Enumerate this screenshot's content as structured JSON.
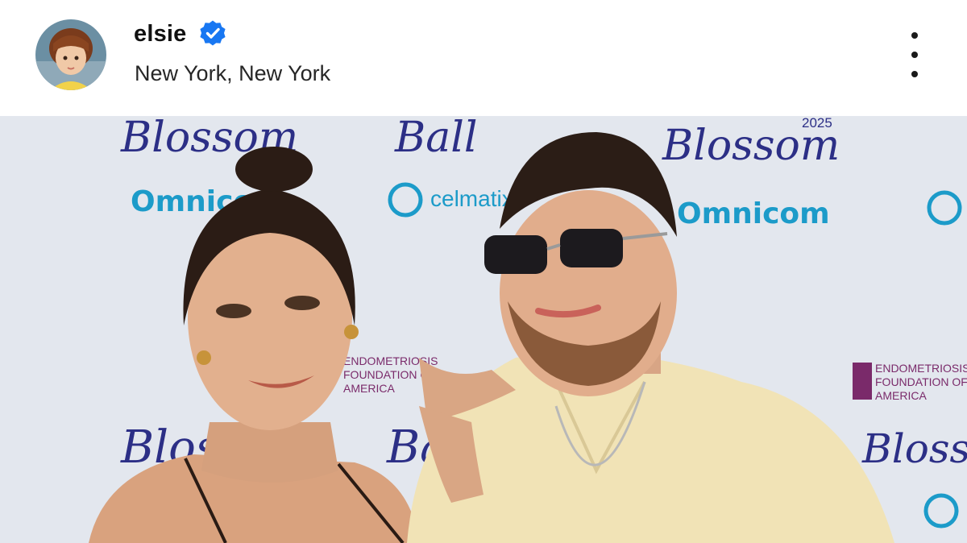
{
  "post_header": {
    "username": "elsie",
    "verified": true,
    "location": "New York, New York",
    "avatar_icon": "profile-photo-child",
    "more_icon": "more-vertical-icon"
  },
  "post_image": {
    "backdrop": {
      "year": "2025",
      "event_words": [
        "Blossom",
        "Ball"
      ],
      "sponsors": [
        "Omnicom",
        "celmatix"
      ],
      "foundation_lines": [
        "ENDOMETRIOSIS",
        "FOUNDATION OF",
        "AMERICA"
      ]
    }
  },
  "colors": {
    "verified_blue": "#1877f2",
    "backdrop": "#e6e9ef",
    "script_navy": "#2c2f86",
    "sponsor_blue": "#1c9bc9"
  }
}
